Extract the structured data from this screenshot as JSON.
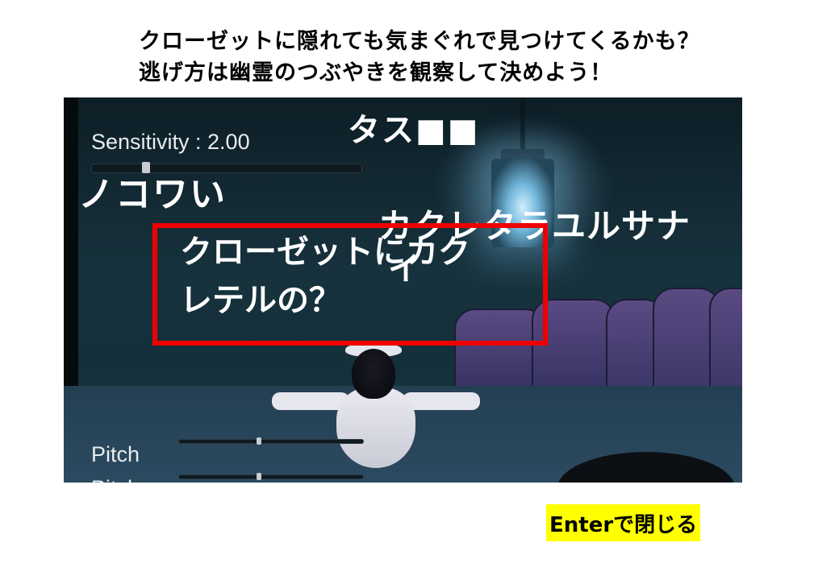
{
  "instructions": {
    "line1": "クローゼットに隠れても気まぐれで見つけてくるかも？",
    "line2": "逃げ方は幽霊のつぶやきを観察して決めよう！"
  },
  "game": {
    "settings": {
      "sensitivity_label": "Sensitivity : 2.00",
      "sensitivity_value": 2.0,
      "pitch_label": "Pitch",
      "pitch2_label": "Pitch"
    },
    "overlay_text": {
      "task": "タス■■",
      "kowai": "ノコワい",
      "kakure": "カクレタラユルサナ",
      "stray": "イ"
    },
    "dialog": {
      "line1": "クローゼットにカク",
      "line2": "レテルの？"
    }
  },
  "close_hint": "Enterで閉じる",
  "colors": {
    "highlight_box": "#ee0000",
    "hint_background": "#ffff00"
  }
}
